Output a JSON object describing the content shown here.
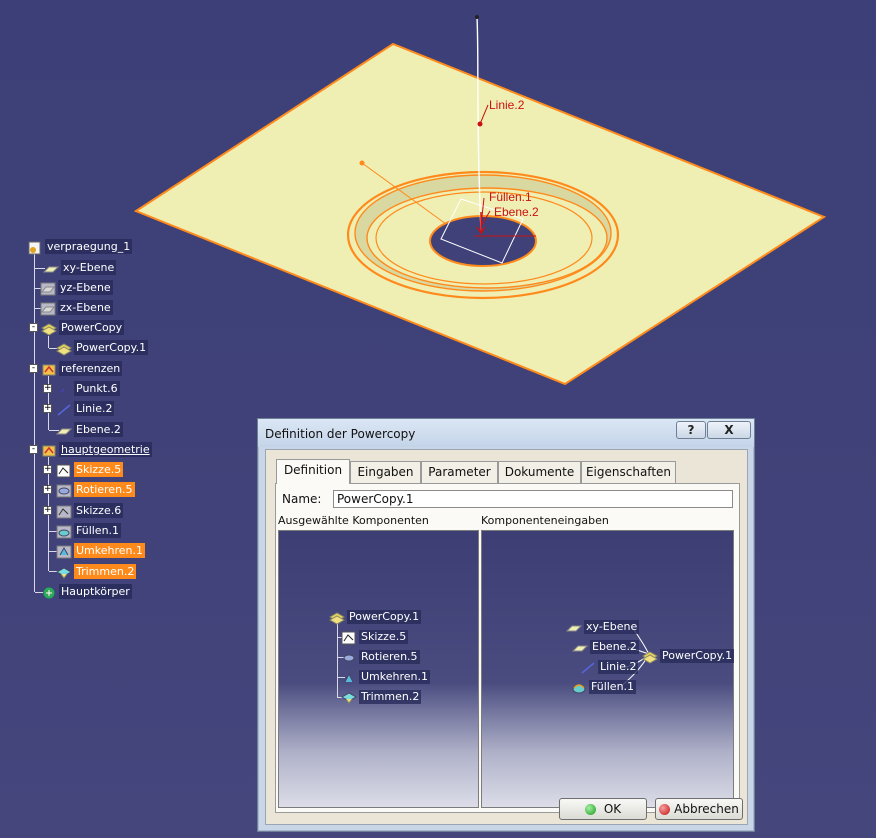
{
  "viewport_labels": {
    "line": "Linie.2",
    "fill": "Füllen.1",
    "plane": "Ebene.2"
  },
  "tree": {
    "root": "verpraegung_1",
    "xy_plane": "xy-Ebene",
    "yz_plane": "yz-Ebene",
    "zx_plane": "zx-Ebene",
    "powercopy_set": "PowerCopy",
    "powercopy_1": "PowerCopy.1",
    "references": "referenzen",
    "point6": "Punkt.6",
    "line2": "Linie.2",
    "plane2": "Ebene.2",
    "main_geometry": "hauptgeometrie",
    "sketch5": "Skizze.5",
    "rotate5": "Rotieren.5",
    "sketch6": "Skizze.6",
    "fill1": "Füllen.1",
    "invert1": "Umkehren.1",
    "trim2": "Trimmen.2",
    "main_body": "Hauptkörper"
  },
  "dialog": {
    "title": "Definition der Powercopy",
    "help_btn": "?",
    "close_btn": "X",
    "tabs": [
      "Definition",
      "Eingaben",
      "Parameter",
      "Dokumente",
      "Eigenschaften"
    ],
    "name_label": "Name:",
    "name_value": "PowerCopy.1",
    "left_header": "Ausgewählte Komponenten",
    "right_header": "Komponenteneingaben",
    "left_tree": {
      "root": "PowerCopy.1",
      "items": [
        "Skizze.5",
        "Rotieren.5",
        "Umkehren.1",
        "Trimmen.2"
      ]
    },
    "right_graph": {
      "inputs": [
        "xy-Ebene",
        "Ebene.2",
        "Linie.2",
        "Füllen.1"
      ],
      "target": "PowerCopy.1"
    },
    "ok": "OK",
    "cancel": "Abbrechen"
  },
  "colors": {
    "background": "#3f4178",
    "plate": "#efefb4",
    "edge": "#ff8a1c",
    "highlight": "#ff8a1c",
    "label3d": "#cc1111"
  }
}
